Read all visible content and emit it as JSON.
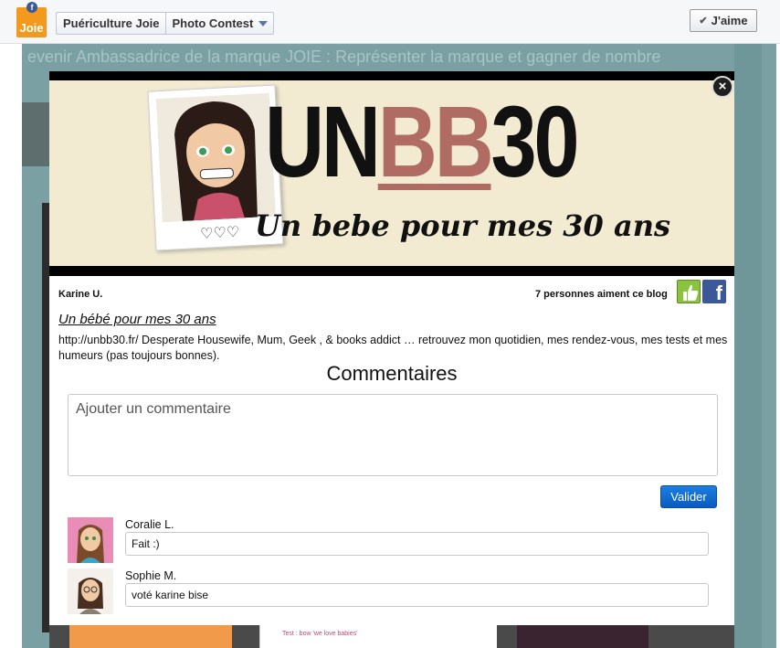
{
  "header": {
    "page_name": "Puériculture Joie",
    "app_name": "Photo Contest",
    "like_label": "J'aime",
    "logo_text": "Joie",
    "fb_badge": "f"
  },
  "background": {
    "marquee": "evenir Ambassadrice de la marque JOIE : Représenter la marque et gagner de nombre",
    "bottom_label": "Test : bow 'we love babies'"
  },
  "modal": {
    "close_label": "×",
    "banner": {
      "title_part1": "UN",
      "title_part2": "BB",
      "title_part3": "30",
      "subtitle": "Un bebe pour mes 30 ans",
      "hearts": "♡♡♡"
    },
    "author": "Karine U.",
    "likes_text": "7 personnes aiment ce blog",
    "blog_title": "Un bébé pour mes 30 ans",
    "blog_desc": "http://unbb30.fr/ Desperate Housewife, Mum, Geek ,  & books addict … retrouvez mon quotidien, mes rendez-vous, mes tests et mes humeurs (pas toujours bonnes).",
    "comments_heading": "Commentaires",
    "comment_placeholder": "Ajouter un commentaire",
    "submit_label": "Valider",
    "comments": [
      {
        "name": "Coralie L.",
        "text": "Fait :)"
      },
      {
        "name": "Sophie M.",
        "text": "voté karine bise"
      }
    ]
  },
  "colors": {
    "brand_orange": "#f39a1c",
    "facebook_blue": "#3b5998",
    "accent_rose": "#b06b62",
    "submit_blue": "#0a5bbf"
  }
}
